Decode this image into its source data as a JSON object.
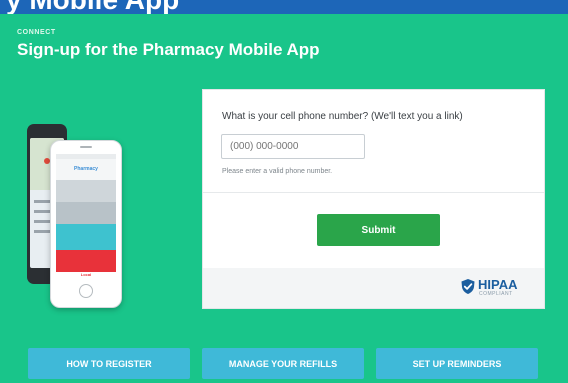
{
  "header_fragment": "y Mobile App",
  "section": {
    "eyebrow": "CONNECT",
    "title": "Sign-up for the Pharmacy Mobile App"
  },
  "phone_mockup": {
    "app_name": "Pharmacy",
    "footer_brand": "Local"
  },
  "form": {
    "question": "What is your cell phone number? (We'll text you a link)",
    "phone_placeholder": "(000) 000-0000",
    "hint": "Please enter a valid phone number.",
    "submit_label": "Submit"
  },
  "badge": {
    "word": "HIPAA",
    "sub": "COMPLIANT"
  },
  "bottom_buttons": [
    {
      "label": "HOW TO REGISTER"
    },
    {
      "label": "MANAGE YOUR REFILLS"
    },
    {
      "label": "SET UP REMINDERS"
    }
  ],
  "colors": {
    "panel": "#19c58a",
    "top_strip": "#1d66b8",
    "submit": "#2aa54a",
    "bottom_buttons": "#3fb9d8",
    "hipaa": "#1b5e9f"
  }
}
